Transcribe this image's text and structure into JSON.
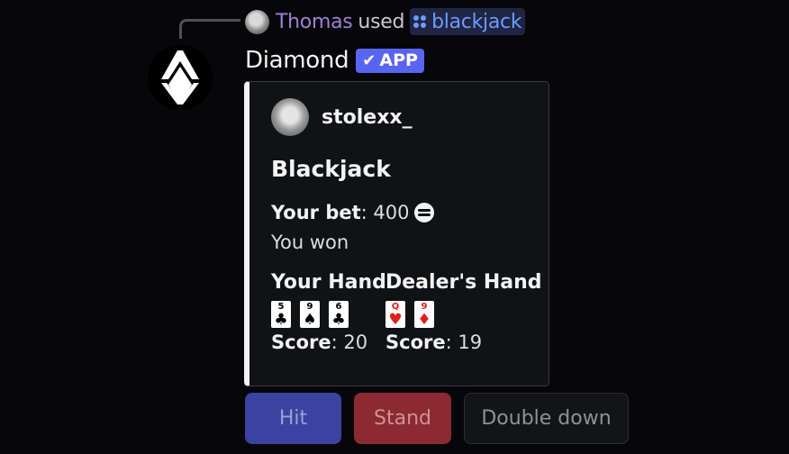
{
  "interaction": {
    "user": "Thomas",
    "action": "used",
    "command": "blackjack"
  },
  "message": {
    "author": "Diamond",
    "app_badge": "APP",
    "app_badge_icon": "checkmark-icon"
  },
  "embed": {
    "author": "stolexx_",
    "title": "Blackjack",
    "bet_label": "Your bet",
    "bet_value": ": 400",
    "bet_icon": "coins-icon",
    "result": "You won",
    "player": {
      "heading": "Your Hand",
      "cards": [
        {
          "rank": "5",
          "suit": "♣",
          "color": "black"
        },
        {
          "rank": "9",
          "suit": "♠",
          "color": "black"
        },
        {
          "rank": "6",
          "suit": "♣",
          "color": "black"
        }
      ],
      "score_label": "Score",
      "score_value": ": 20"
    },
    "dealer": {
      "heading": "Dealer's Hand",
      "cards": [
        {
          "rank": "Q",
          "suit": "♥",
          "color": "red"
        },
        {
          "rank": "9",
          "suit": "♦",
          "color": "red"
        }
      ],
      "score_label": "Score",
      "score_value": ": 19"
    }
  },
  "buttons": {
    "hit": "Hit",
    "stand": "Stand",
    "double_down": "Double down"
  },
  "colors": {
    "accent": "#5865f2",
    "username": "#a07fd1",
    "command": "#6c9bff",
    "hit_button": "#3a43a0",
    "stand_button": "#8b2a31"
  }
}
